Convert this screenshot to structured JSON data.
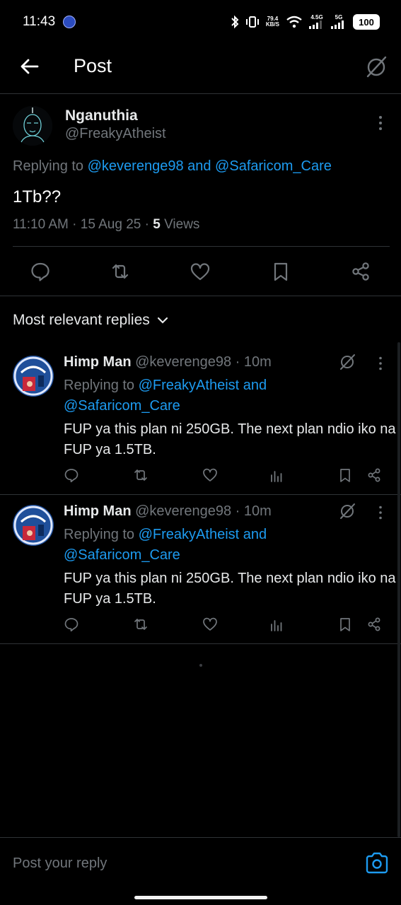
{
  "status_bar": {
    "time": "11:43",
    "net_speed_top": "79.4",
    "net_speed_unit": "KB/S",
    "sim1_label": "4.5G",
    "sim2_label": "5G",
    "battery": "100"
  },
  "header": {
    "title": "Post"
  },
  "post": {
    "author_name": "Nganuthia",
    "author_handle": "@FreakyAtheist",
    "replying_prefix": "Replying to ",
    "replying_targets": "@keverenge98 and @Safaricom_Care",
    "text": "1Tb??",
    "time_date": "11:10 AM · 15 Aug 25 · ",
    "views_count": "5",
    "views_label": " Views"
  },
  "replies_sort": {
    "label": "Most relevant replies"
  },
  "replies": [
    {
      "name": "Himp Man",
      "handle_time": "@keverenge98 · 10m",
      "replying_prefix": "Replying to ",
      "replying_line1": "@FreakyAtheist and",
      "replying_line2": "@Safaricom_Care",
      "text": "FUP ya this plan ni 250GB. The next plan ndio iko na FUP ya 1.5TB."
    },
    {
      "name": "Himp Man",
      "handle_time": "@keverenge98 · 10m",
      "replying_prefix": "Replying to ",
      "replying_line1": "@FreakyAtheist and",
      "replying_line2": "@Safaricom_Care",
      "text": "FUP ya this plan ni 250GB. The next plan ndio iko na FUP ya 1.5TB."
    }
  ],
  "composer": {
    "placeholder": "Post your reply"
  },
  "colors": {
    "background": "#000000",
    "accent": "#1d9bf0",
    "muted": "#71767b",
    "divider": "#2f3336"
  },
  "icons": [
    "back-arrow-icon",
    "grok-icon",
    "more-vertical-icon",
    "reply-icon",
    "repost-icon",
    "like-icon",
    "bookmark-icon",
    "share-icon",
    "views-icon",
    "chevron-down-icon",
    "camera-icon"
  ]
}
